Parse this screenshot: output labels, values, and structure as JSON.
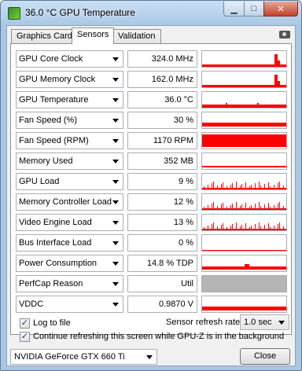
{
  "window": {
    "title": "36.0 °C GPU Temperature",
    "minimize_glyph": "▁",
    "maximize_glyph": "□",
    "close_glyph": "✕"
  },
  "tabs": [
    {
      "label": "Graphics Card",
      "active": false
    },
    {
      "label": "Sensors",
      "active": true
    },
    {
      "label": "Validation",
      "active": false
    }
  ],
  "sensors": [
    {
      "name": "GPU Core Clock",
      "value": "324.0 MHz",
      "graph": "spike"
    },
    {
      "name": "GPU Memory Clock",
      "value": "162.0 MHz",
      "graph": "spike"
    },
    {
      "name": "GPU Temperature",
      "value": "36.0 °C",
      "graph": "low"
    },
    {
      "name": "Fan Speed (%)",
      "value": "30 %",
      "graph": "band"
    },
    {
      "name": "Fan Speed (RPM)",
      "value": "1170 RPM",
      "graph": "full"
    },
    {
      "name": "Memory Used",
      "value": "352 MB",
      "graph": "line"
    },
    {
      "name": "GPU Load",
      "value": "9 %",
      "graph": "noise"
    },
    {
      "name": "Memory Controller Load",
      "value": "12 %",
      "graph": "noise"
    },
    {
      "name": "Video Engine Load",
      "value": "13 %",
      "graph": "noise"
    },
    {
      "name": "Bus Interface Load",
      "value": "0 %",
      "graph": "empty"
    },
    {
      "name": "Power Consumption",
      "value": "14.8 % TDP",
      "graph": "band-bump"
    },
    {
      "name": "PerfCap Reason",
      "value": "Util",
      "graph": "gray"
    },
    {
      "name": "VDDC",
      "value": "0.9870 V",
      "graph": "band"
    }
  ],
  "options": {
    "log_to_file": {
      "label": "Log to file",
      "checked": true
    },
    "continue_refreshing": {
      "label": "Continue refreshing this screen while GPU-Z is in the background",
      "checked": true
    },
    "refresh_label": "Sensor refresh rate:",
    "refresh_value": "1.0 sec"
  },
  "footer": {
    "gpu_select": "NVIDIA GeForce GTX 660 Ti",
    "close_button": "Close"
  },
  "colors": {
    "graph": "#ff0000",
    "perfcap_gray": "#b5b5b5"
  }
}
